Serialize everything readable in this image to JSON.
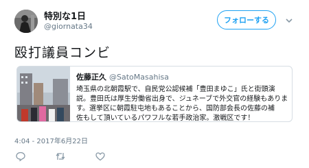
{
  "user": {
    "display_name": "特別な1日",
    "handle": "@giornata34"
  },
  "follow_label": "フォローする",
  "tweet_text": "殴打議員コンビ",
  "quote": {
    "author_name": "佐藤正久",
    "author_handle": "@SatoMasahisa",
    "lines": [
      "埼玉県の北朝霞駅で、自民党公認候補「豊田まゆこ」氏と街頭演",
      "説。豊田氏は厚生労働省出身で、ジュネーブで外交官の経験もありま",
      "す。選挙区に朝霞駐屯地もあることから、国防部会長の佐藤の補",
      "佐もして頂いているパワフルな若手政治家。激戦区です！"
    ]
  },
  "timestamp": "4:04 - 2017年6月22日",
  "icons": {
    "dropdown": "chevron-down-icon",
    "reply": "reply-icon",
    "retweet": "retweet-icon",
    "like": "heart-icon"
  },
  "colors": {
    "accent": "#1da1f2",
    "text": "#14171a",
    "secondary": "#657786",
    "border": "#d6dde3"
  }
}
